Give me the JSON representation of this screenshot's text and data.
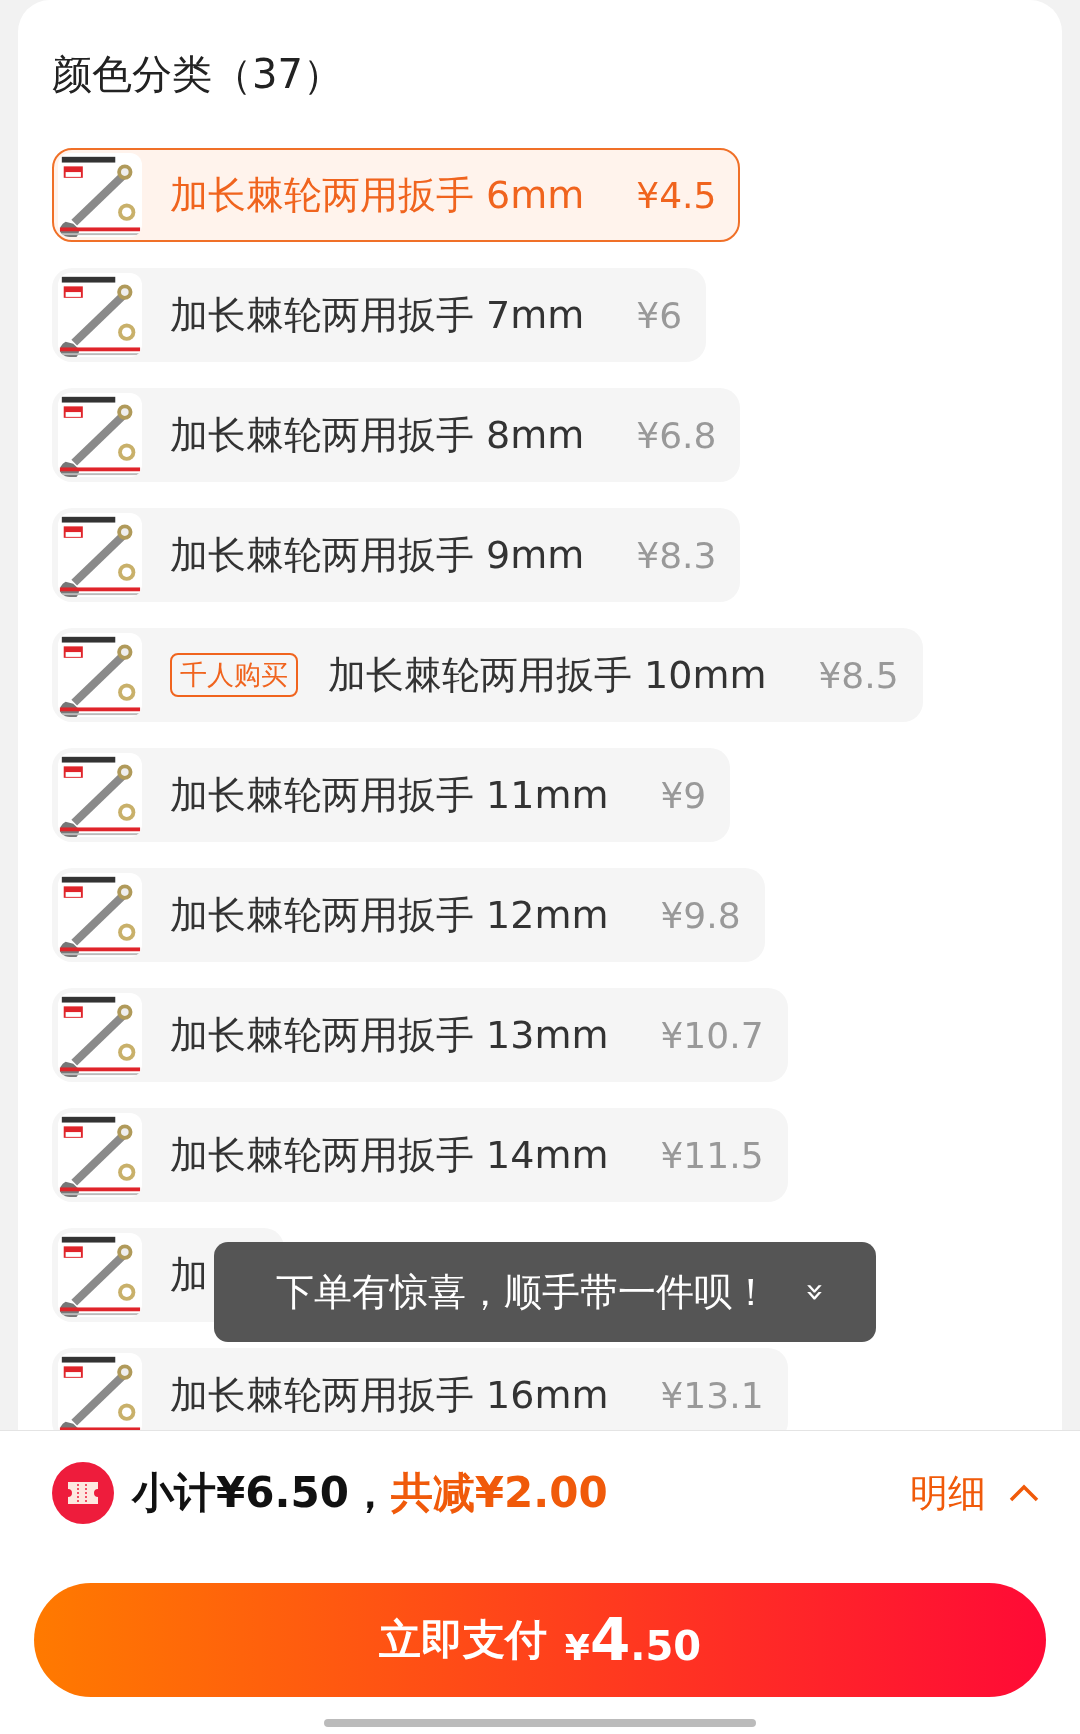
{
  "section_title": "颜色分类（37）",
  "options": [
    {
      "name": "加长棘轮两用扳手 6mm",
      "price": "¥4.5",
      "selected": true
    },
    {
      "name": "加长棘轮两用扳手 7mm",
      "price": "¥6",
      "selected": false
    },
    {
      "name": "加长棘轮两用扳手 8mm",
      "price": "¥6.8",
      "selected": false
    },
    {
      "name": "加长棘轮两用扳手 9mm",
      "price": "¥8.3",
      "selected": false
    },
    {
      "name": "加长棘轮两用扳手 10mm",
      "price": "¥8.5",
      "badge": "千人购买",
      "selected": false
    },
    {
      "name": "加长棘轮两用扳手 11mm",
      "price": "¥9",
      "selected": false
    },
    {
      "name": "加长棘轮两用扳手 12mm",
      "price": "¥9.8",
      "selected": false
    },
    {
      "name": "加长棘轮两用扳手 13mm",
      "price": "¥10.7",
      "selected": false
    },
    {
      "name": "加长棘轮两用扳手 14mm",
      "price": "¥11.5",
      "selected": false
    },
    {
      "name": "加",
      "selected": false
    },
    {
      "name": "加长棘轮两用扳手 16mm",
      "price": "¥13.1",
      "selected": false
    }
  ],
  "toast": {
    "text": "下单有惊喜，顺手带一件呗！",
    "chevron": "»"
  },
  "summary": {
    "subtotal": "小计¥6.50，",
    "discount": "共减¥2.00",
    "details": "明细"
  },
  "pay_button": {
    "label": "立即支付",
    "currency": "¥",
    "amount_major": "4",
    "amount_minor": ".50"
  }
}
